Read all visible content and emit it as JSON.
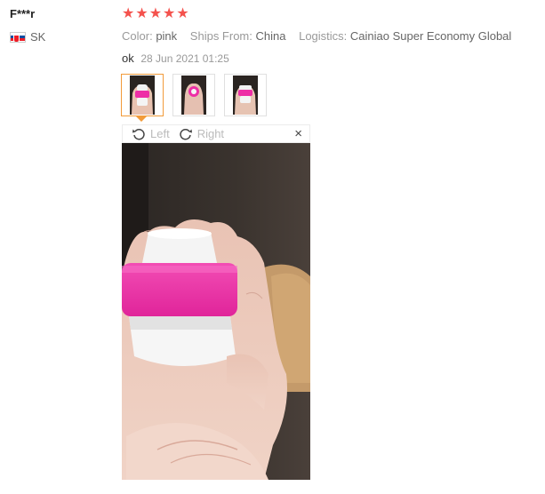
{
  "user": {
    "name": "F***r",
    "country_code": "SK",
    "flag_icon": "slovakia-flag-icon"
  },
  "rating": {
    "stars": 5,
    "max": 5,
    "color": "#f4524d"
  },
  "attributes": [
    {
      "label": "Color:",
      "value": "pink"
    },
    {
      "label": "Ships From:",
      "value": "China"
    },
    {
      "label": "Logistics:",
      "value": "Cainiao Super Economy Global"
    }
  ],
  "review": {
    "text": "ok",
    "date": "28 Jun 2021 01:25"
  },
  "photos": {
    "count": 3,
    "active_index": 0,
    "accent": "#f29b3a"
  },
  "viewer": {
    "rotate_left_label": "Left",
    "rotate_right_label": "Right",
    "close_symbol": "×"
  }
}
